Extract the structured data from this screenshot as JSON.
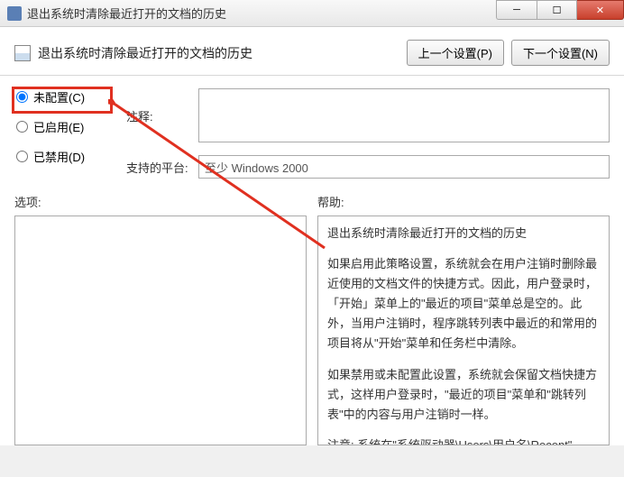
{
  "titlebar": {
    "title": "退出系统时清除最近打开的文档的历史"
  },
  "header": {
    "setting_title": "退出系统时清除最近打开的文档的历史",
    "prev_button": "上一个设置(P)",
    "next_button": "下一个设置(N)"
  },
  "radios": {
    "not_configured": "未配置(C)",
    "enabled": "已启用(E)",
    "disabled": "已禁用(D)",
    "selected": "not_configured"
  },
  "fields": {
    "comment_label": "注释:",
    "platform_label": "支持的平台:",
    "platform_value": "至少 Windows 2000"
  },
  "lower": {
    "options_label": "选项:",
    "help_label": "帮助:"
  },
  "help_text": {
    "p1": "退出系统时清除最近打开的文档的历史",
    "p2": "如果启用此策略设置，系统就会在用户注销时删除最近使用的文档文件的快捷方式。因此，用户登录时，「开始」菜单上的\"最近的项目\"菜单总是空的。此外，当用户注销时，程序跳转列表中最近的和常用的项目将从\"开始\"菜单和任务栏中清除。",
    "p3": "如果禁用或未配置此设置，系统就会保留文档快捷方式，这样用户登录时，\"最近的项目\"菜单和\"跳转列表\"中的内容与用户注销时一样。",
    "p4": "注意: 系统在\"系统驱动器\\Users\\用户名\\Recent\""
  }
}
